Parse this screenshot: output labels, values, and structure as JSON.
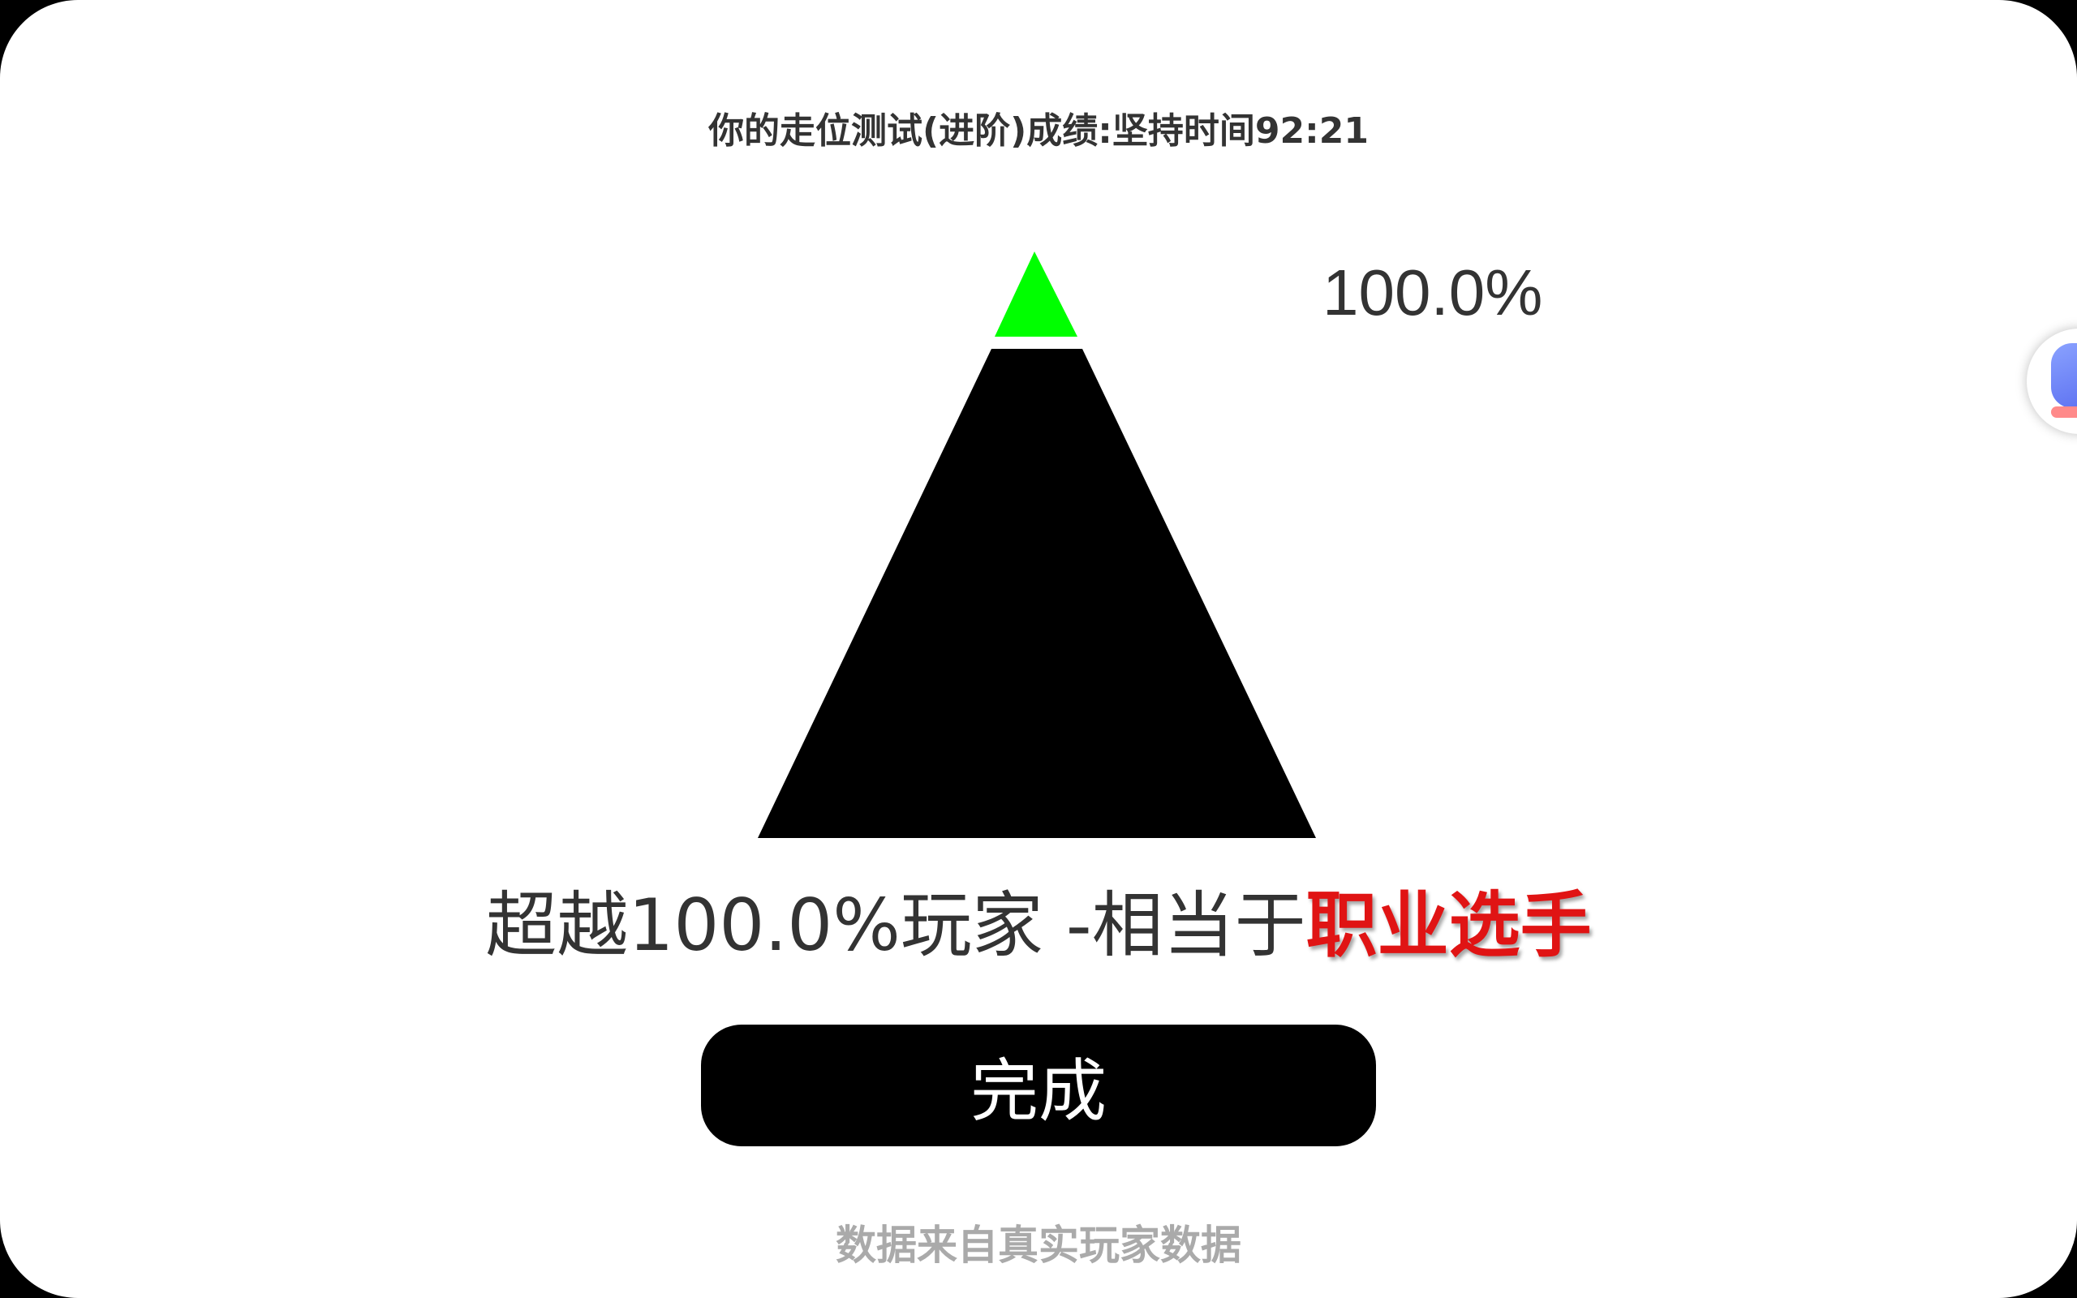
{
  "header": {
    "title": "你的走位测试(进阶)成绩:坚持时间92:21"
  },
  "pyramid": {
    "percent_label": "100.0%",
    "progress": 1.0,
    "top_color": "#00ff00",
    "body_color": "#000000"
  },
  "result": {
    "prefix": "超越100.0%玩家 -相当于",
    "rank": "职业选手",
    "rank_color": "#e01414"
  },
  "actions": {
    "done_label": "完成"
  },
  "footer": {
    "note": "数据来自真实玩家数据"
  },
  "widgets": {
    "floating_icon": "floating-assistant-icon"
  }
}
